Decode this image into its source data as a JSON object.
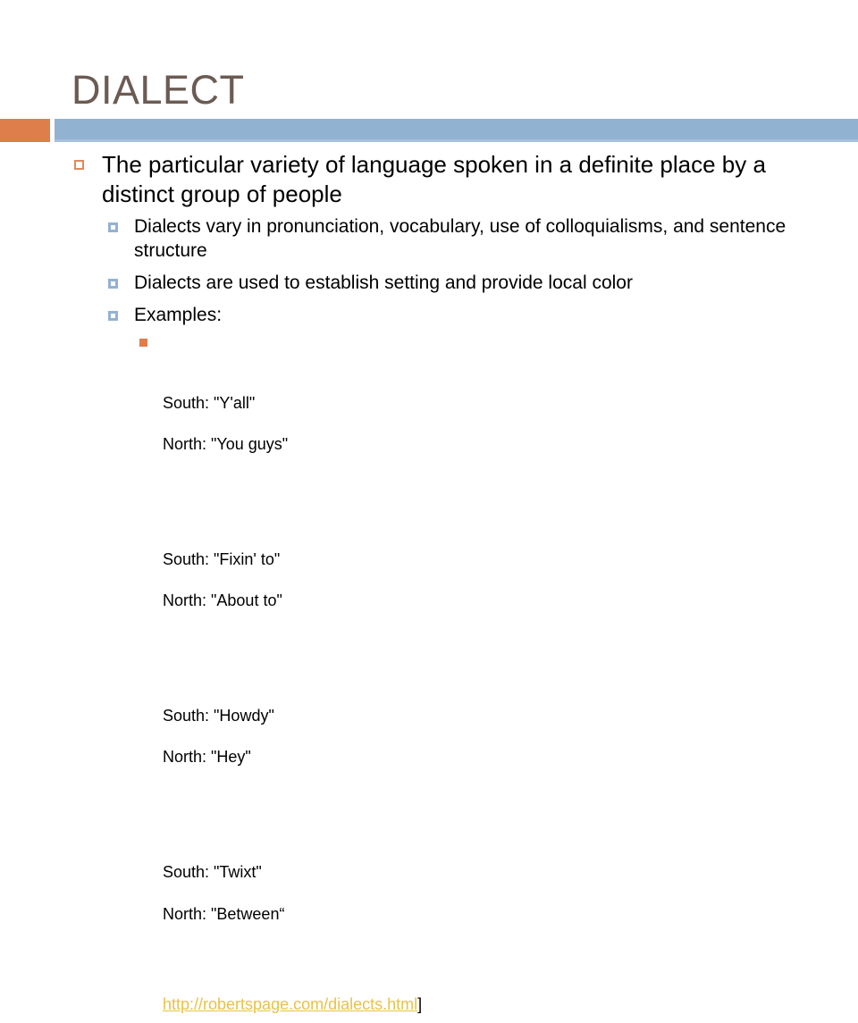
{
  "slide": {
    "title": "DIALECT",
    "theme": {
      "title_color": "#6B5B52",
      "accent_orange": "#DD7E4B",
      "accent_blue": "#92B2D2",
      "link_color": "#E8C247",
      "body_color": "#000000",
      "background": "#FFFFFF"
    },
    "bullets": {
      "level1": "The particular variety of language spoken in a definite place by a distinct group of people",
      "level2": [
        "Dialects vary in pronunciation, vocabulary, use of colloquialisms, and sentence structure",
        "Dialects are used to establish setting and provide local color",
        "Examples:"
      ]
    },
    "examples": [
      {
        "south": "South: \"Y'all\"",
        "north": "North: \"You guys\""
      },
      {
        "south": "South: \"Fixin' to\"",
        "north": "North: \"About to\""
      },
      {
        "south": "South: \"Howdy\"",
        "north": "North: \"Hey\""
      },
      {
        "south": "South: \"Twixt\"",
        "north": "North: \"Between“"
      }
    ],
    "link": {
      "text": "http://robertspage.com/dialects.html",
      "trailing": "]"
    }
  }
}
